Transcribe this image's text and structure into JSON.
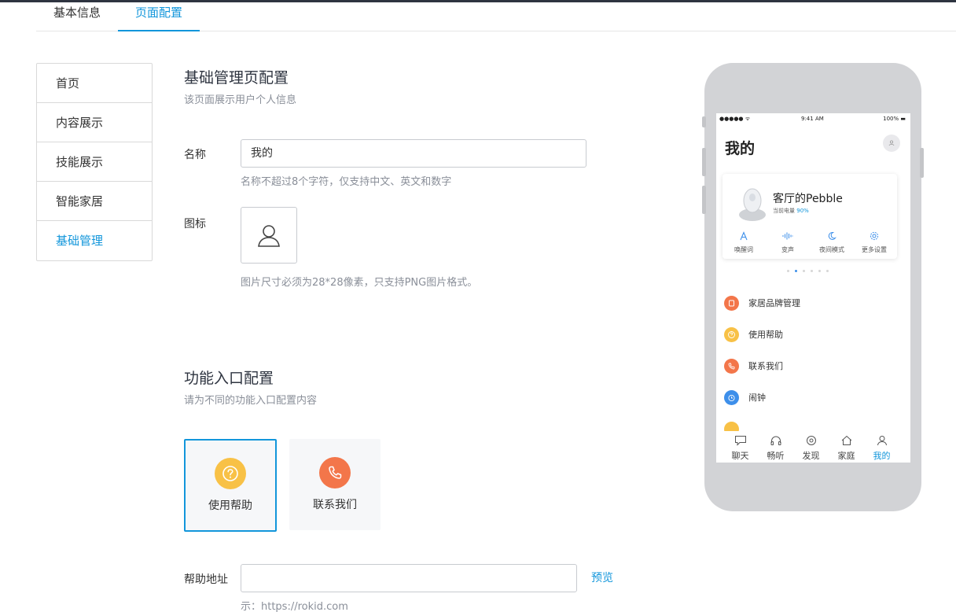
{
  "tabs": [
    "基本信息",
    "页面配置"
  ],
  "side_menu": [
    "首页",
    "内容展示",
    "技能展示",
    "智能家居",
    "基础管理"
  ],
  "section1": {
    "title": "基础管理页配置",
    "desc": "该页面展示用户个人信息",
    "name_label": "名称",
    "name_value": "我的",
    "name_hint": "名称不超过8个字符，仅支持中文、英文和数字",
    "icon_label": "图标",
    "icon_hint": "图片尺寸必须为28*28像素，只支持PNG图片格式。"
  },
  "section2": {
    "title": "功能入口配置",
    "desc": "请为不同的功能入口配置内容",
    "cards": [
      {
        "label": "使用帮助",
        "color": "#f8c146",
        "icon": "question-circle-icon"
      },
      {
        "label": "联系我们",
        "color": "#f3764a",
        "icon": "phone-icon"
      }
    ],
    "help_label": "帮助地址",
    "help_value": "",
    "help_hint": "示：https://rokid.com",
    "preview": "预览"
  },
  "phone": {
    "status_left": "●●●●● ᯤ",
    "status_time": "9:41 AM",
    "status_right": "100% ▬",
    "title": "我的",
    "device_name": "客厅的Pebble",
    "battery_label": "当前电量",
    "battery_value": "90%",
    "actions": [
      "唤醒词",
      "变声",
      "夜间模式",
      "更多设置"
    ],
    "menu": [
      {
        "label": "家居品牌管理",
        "color": "#f3764a"
      },
      {
        "label": "使用帮助",
        "color": "#f8c146"
      },
      {
        "label": "联系我们",
        "color": "#f3764a"
      },
      {
        "label": "闹钟",
        "color": "#3d8fea"
      }
    ],
    "tabbar": [
      "聊天",
      "畅听",
      "发现",
      "家庭",
      "我的"
    ]
  },
  "colors": {
    "accent": "#1296db",
    "border": "#d9d9d9",
    "phone_shell": "#d2d3d6"
  }
}
